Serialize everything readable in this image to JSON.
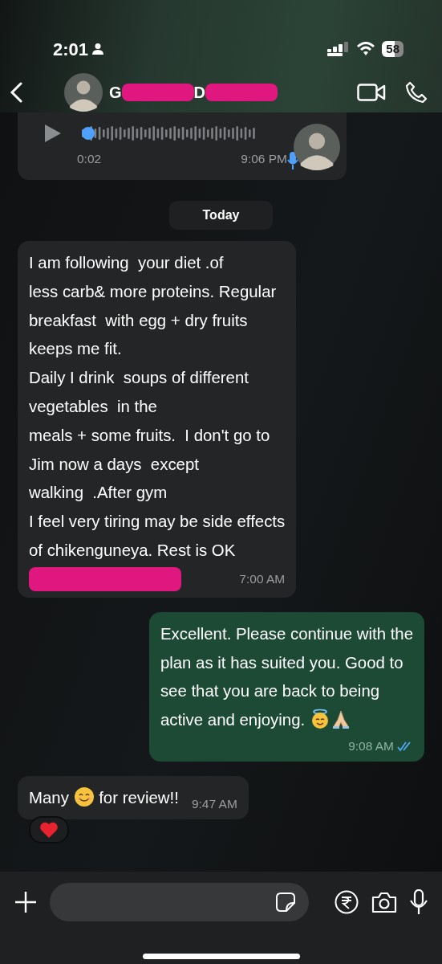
{
  "status_bar": {
    "time": "2:01",
    "battery": "58"
  },
  "header": {
    "name_parts": [
      {
        "text": "G",
        "redacted_after": true
      },
      {
        "text": "D",
        "redacted_after": true
      }
    ]
  },
  "voice_message": {
    "duration": "0:02",
    "time": "9:06 PM"
  },
  "date_chip": "Today",
  "messages": [
    {
      "kind": "incoming",
      "redacted": true,
      "segments": [
        {
          "text": "I am following  your diet .of\nless carb& more proteins. Regular\nbreakfast  with egg + dry fruits\nkeeps me fit.\nDaily I drink  soups of different\nvegetables  in the\nmeals + some fruits.  I don't go to\nJim now a days  except\nwalking  .After gym\nI feel very tiring may be side effects\nof chikenguneya. Rest is OK"
        }
      ],
      "time": "7:00 AM"
    },
    {
      "kind": "outgoing",
      "read": true,
      "segments": [
        {
          "text": "Excellent. Please continue with the\nplan as it has suited you. Good to\nsee that you are back to being\nactive and enjoying. "
        },
        {
          "kind": "angel"
        },
        {
          "kind": "pray"
        }
      ],
      "time": "9:08 AM"
    },
    {
      "kind": "incoming",
      "reaction": {
        "kind": "heart"
      },
      "segments": [
        {
          "text": "Many "
        },
        {
          "kind": "smile"
        },
        {
          "text": " for review!!"
        }
      ],
      "time": "9:47 AM"
    }
  ]
}
